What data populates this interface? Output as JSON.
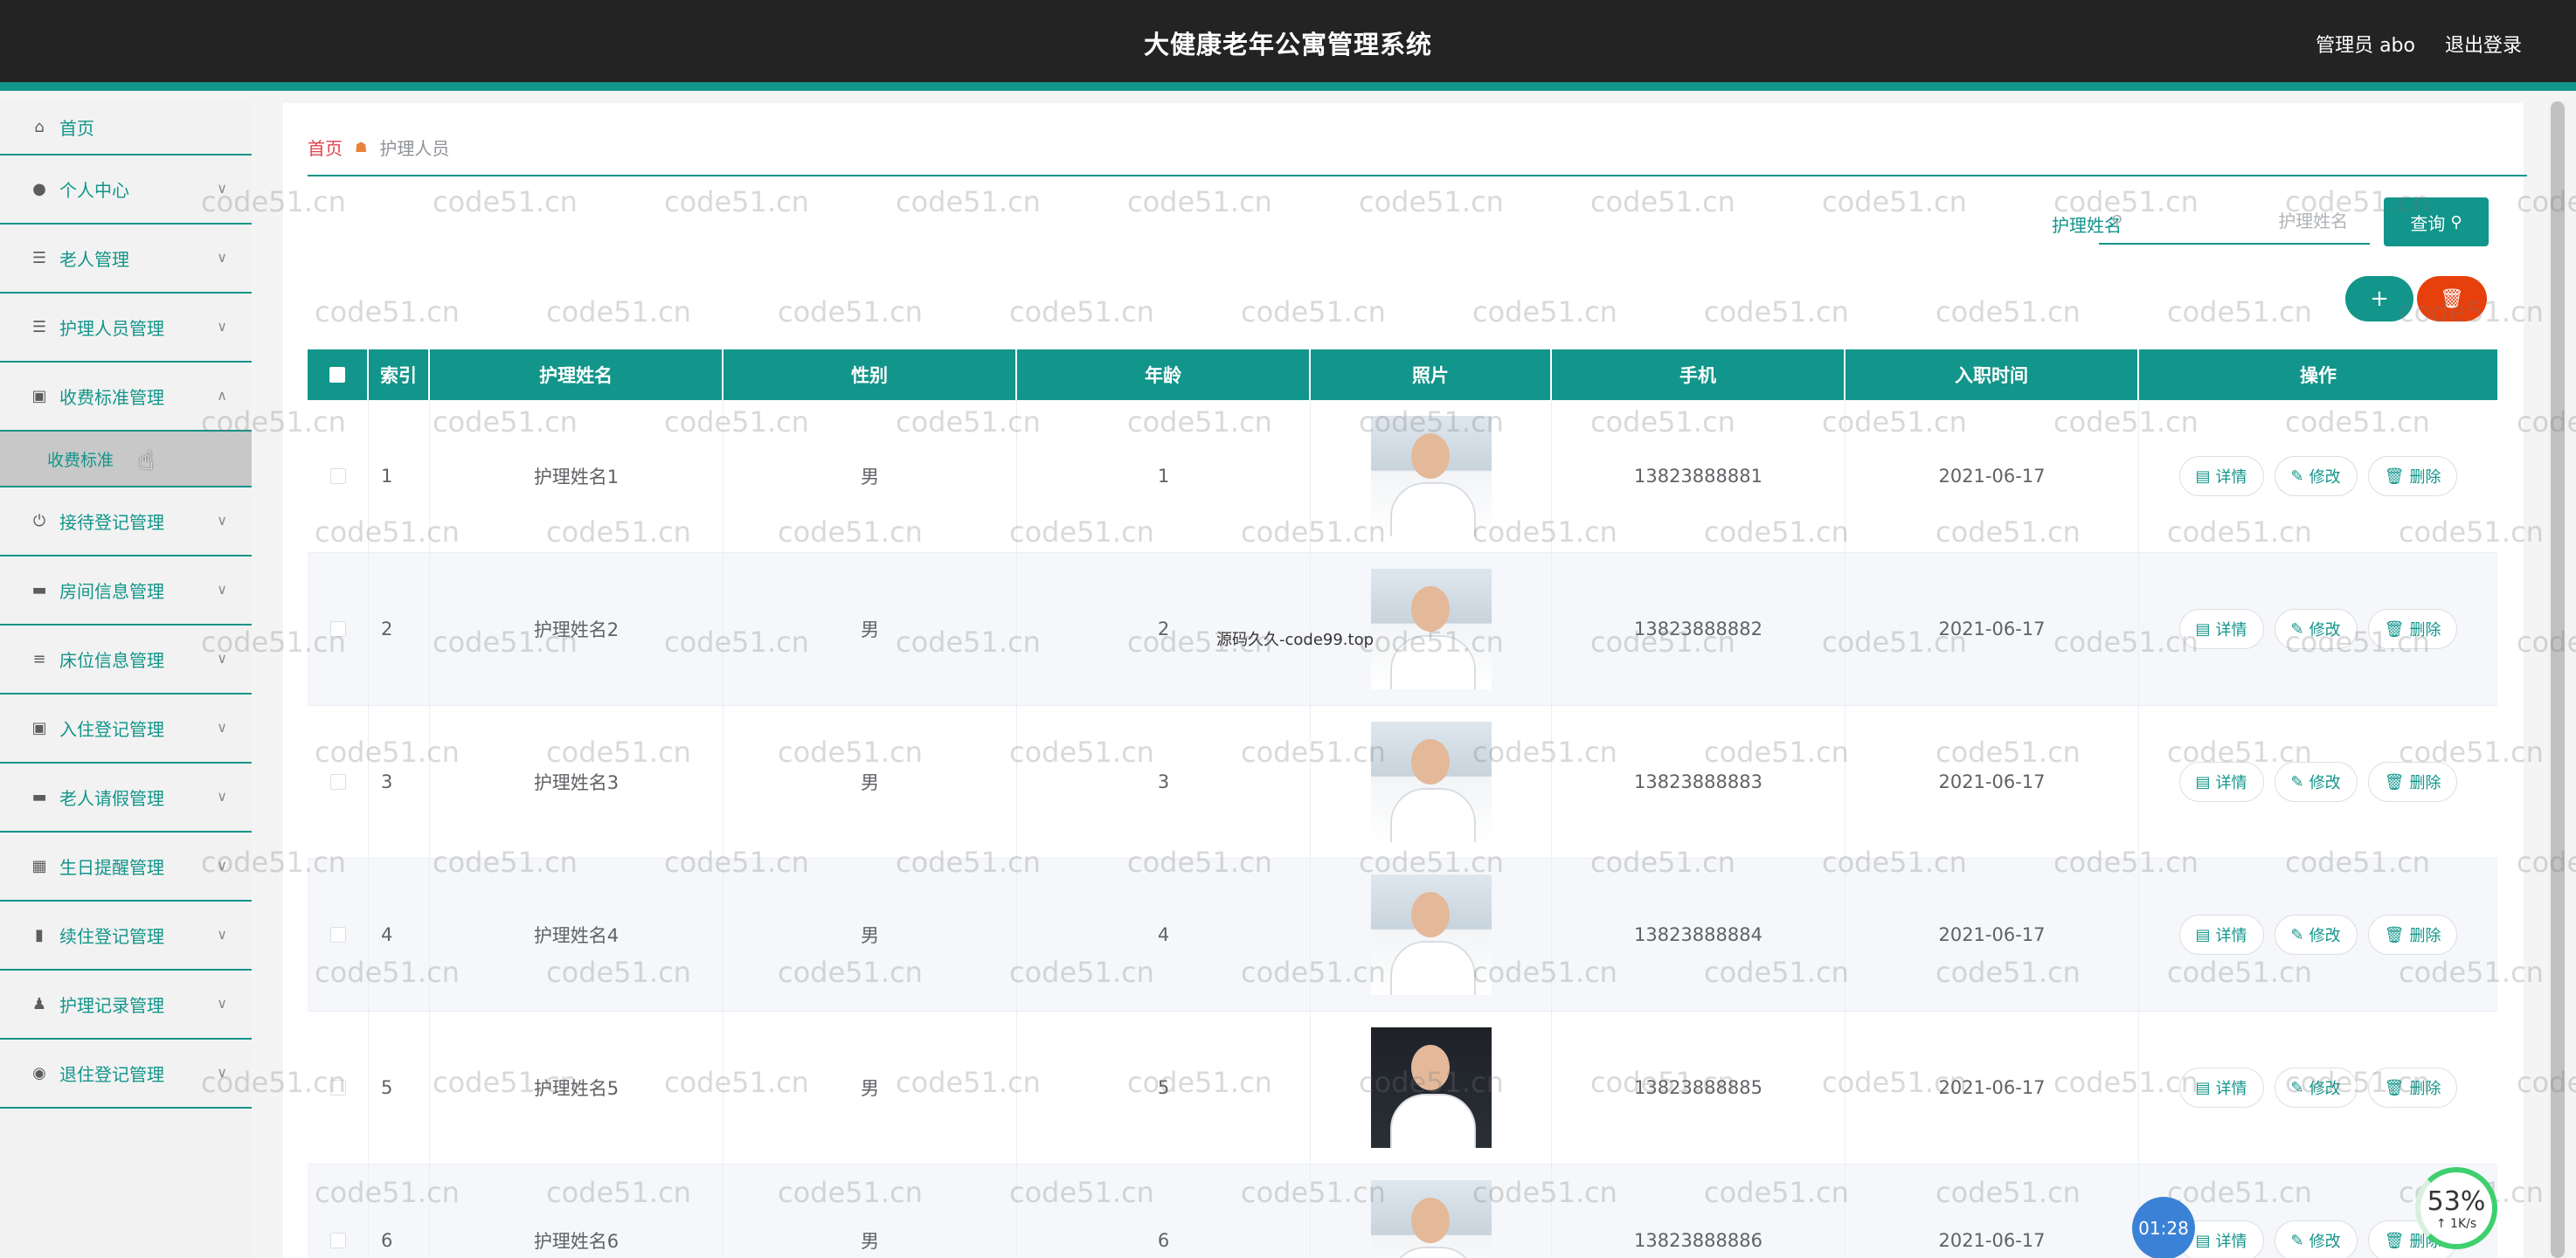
{
  "header": {
    "title": "大健康老年公寓管理系统",
    "user": "管理员 abo",
    "logout": "退出登录"
  },
  "sidebar": {
    "items": [
      {
        "label": "首页",
        "icon": "home-icon"
      },
      {
        "label": "个人中心",
        "icon": "user-icon"
      },
      {
        "label": "老人管理",
        "icon": "list-icon"
      },
      {
        "label": "护理人员管理",
        "icon": "list-icon"
      },
      {
        "label": "收费标准管理",
        "icon": "clipboard-icon",
        "expanded": true
      },
      {
        "label": "接待登记管理",
        "icon": "power-icon"
      },
      {
        "label": "房间信息管理",
        "icon": "monitor-icon"
      },
      {
        "label": "床位信息管理",
        "icon": "sliders-icon"
      },
      {
        "label": "入住登记管理",
        "icon": "clipboard-icon"
      },
      {
        "label": "老人请假管理",
        "icon": "monitor-icon"
      },
      {
        "label": "生日提醒管理",
        "icon": "grid-icon"
      },
      {
        "label": "续住登记管理",
        "icon": "bar-chart-icon"
      },
      {
        "label": "护理记录管理",
        "icon": "person-icon"
      },
      {
        "label": "退住登记管理",
        "icon": "bulb-icon"
      }
    ],
    "submenu": {
      "label": "收费标准"
    }
  },
  "breadcrumb": {
    "home": "首页",
    "current": "护理人员"
  },
  "search": {
    "label": "护理姓名",
    "placeholder": "护理姓名",
    "button": "查询"
  },
  "table": {
    "headers": {
      "index": "索引",
      "name": "护理姓名",
      "sex": "性别",
      "age": "年龄",
      "photo": "照片",
      "phone": "手机",
      "date": "入职时间",
      "ops": "操作"
    },
    "op_labels": {
      "detail": "详情",
      "edit": "修改",
      "delete": "删除"
    },
    "rows": [
      {
        "index": "1",
        "name": "护理姓名1",
        "sex": "男",
        "age": "1",
        "phone": "13823888881",
        "date": "2021-06-17"
      },
      {
        "index": "2",
        "name": "护理姓名2",
        "sex": "男",
        "age": "2",
        "phone": "13823888882",
        "date": "2021-06-17"
      },
      {
        "index": "3",
        "name": "护理姓名3",
        "sex": "男",
        "age": "3",
        "phone": "13823888883",
        "date": "2021-06-17"
      },
      {
        "index": "4",
        "name": "护理姓名4",
        "sex": "男",
        "age": "4",
        "phone": "13823888884",
        "date": "2021-06-17"
      },
      {
        "index": "5",
        "name": "护理姓名5",
        "sex": "男",
        "age": "5",
        "phone": "13823888885",
        "date": "2021-06-17"
      },
      {
        "index": "6",
        "name": "护理姓名6",
        "sex": "男",
        "age": "6",
        "phone": "13823888886",
        "date": "2021-06-17"
      }
    ]
  },
  "overlay": {
    "watermark": "code51.cn",
    "center_watermark": "源码久久-code99.top",
    "timer": "01:28",
    "speed_percent": "53%",
    "speed_rate": "↑ 1K/s"
  },
  "colors": {
    "accent": "#12958a",
    "danger": "#e8400c",
    "topbar": "#232323"
  }
}
